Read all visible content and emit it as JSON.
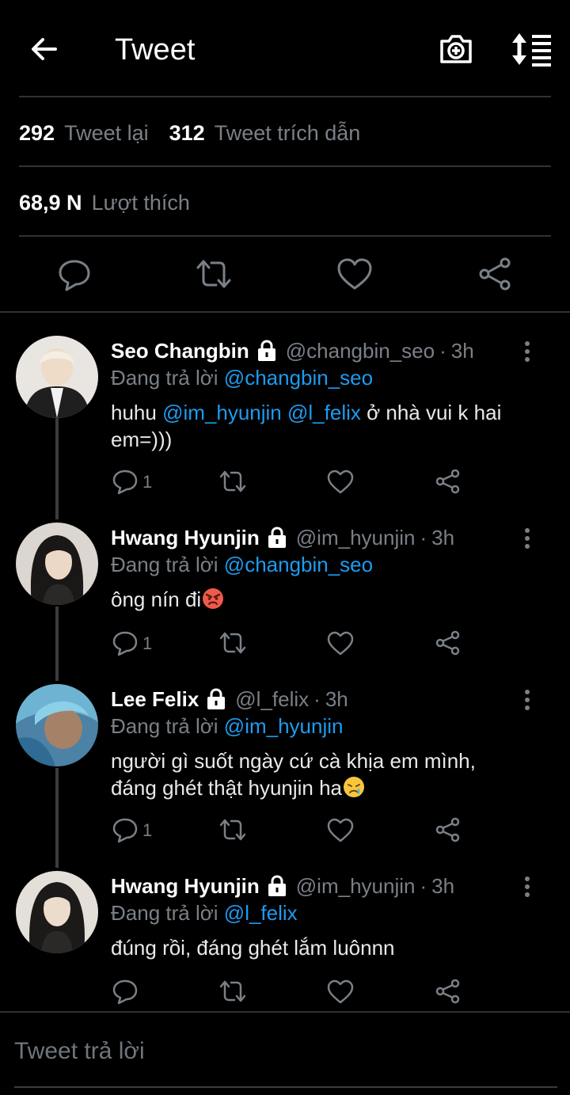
{
  "header": {
    "title": "Tweet"
  },
  "stats": {
    "retweets_num": "292",
    "retweets_label": "Tweet lại",
    "quotes_num": "312",
    "quotes_label": "Tweet trích dẫn",
    "likes_num": "68,9 N",
    "likes_label": "Lượt thích"
  },
  "replies": [
    {
      "name": "Seo Changbin",
      "handle": "@changbin_seo",
      "dot": "·",
      "time": "3h",
      "replying_prefix": "Đang trả lời",
      "replying_to": "@changbin_seo",
      "text_parts": [
        "huhu ",
        "@im_hyunjin",
        " ",
        "@l_felix",
        " ở nhà vui k hai em=)))"
      ],
      "reply_count": "1",
      "avatar_colors": [
        "#e8e4dc",
        "#1a1a1a"
      ]
    },
    {
      "name": "Hwang Hyunjin",
      "handle": "@im_hyunjin",
      "dot": "·",
      "time": "3h",
      "replying_prefix": "Đang trả lời",
      "replying_to": "@changbin_seo",
      "text": "ông nín đi",
      "emoji": "angry-face",
      "reply_count": "1",
      "avatar_colors": [
        "#d8d2cc",
        "#1c1a19"
      ]
    },
    {
      "name": "Lee Felix",
      "handle": "@l_felix",
      "dot": "·",
      "time": "3h",
      "replying_prefix": "Đang trả lời",
      "replying_to": "@im_hyunjin",
      "text_line1": "người gì suốt ngày cứ cà khịa em mình,",
      "text_line2": "đáng ghét thật hyunjin ha",
      "emoji": "crying-face",
      "reply_count": "1",
      "avatar_colors": [
        "#5fa8c8",
        "#9a7a62"
      ]
    },
    {
      "name": "Hwang Hyunjin",
      "handle": "@im_hyunjin",
      "dot": "·",
      "time": "3h",
      "replying_prefix": "Đang trả lời",
      "replying_to": "@l_felix",
      "text": "đúng rồi, đáng ghét lắm luônnn",
      "reply_count": "",
      "avatar_colors": [
        "#e2dcd6",
        "#1c1a19"
      ]
    }
  ],
  "compose": {
    "placeholder": "Tweet trả lời"
  },
  "colors": {
    "background": "#000000",
    "accent": "#1d9bf0",
    "muted": "#7a8087",
    "divider": "#2f3336"
  },
  "icons": [
    "back-arrow-icon",
    "camera-plus-icon",
    "sort-icon",
    "reply-icon",
    "retweet-icon",
    "like-icon",
    "share-icon",
    "lock-icon",
    "more-icon"
  ]
}
